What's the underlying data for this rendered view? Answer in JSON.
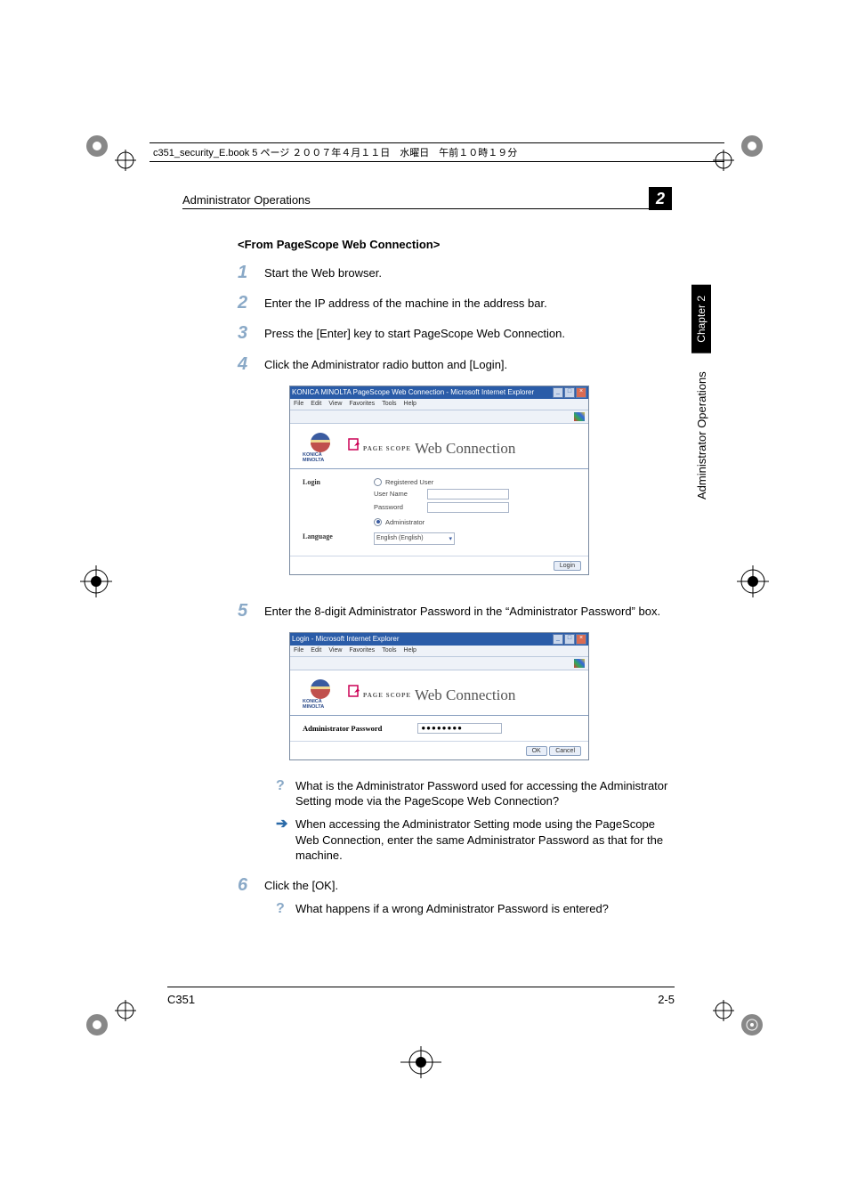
{
  "top_header": "c351_security_E.book  5 ページ  ２００７年４月１１日　水曜日　午前１０時１９分",
  "header": {
    "title": "Administrator Operations",
    "chapter_num": "2"
  },
  "side": {
    "chapter_label": "Chapter 2",
    "section_label": "Administrator Operations"
  },
  "section_title": "<From PageScope Web Connection>",
  "steps": [
    {
      "num": "1",
      "text": "Start the Web browser."
    },
    {
      "num": "2",
      "text": "Enter the IP address of the machine in the address bar."
    },
    {
      "num": "3",
      "text": "Press the [Enter] key to start PageScope Web Connection."
    },
    {
      "num": "4",
      "text": "Click the Administrator radio button and [Login]."
    },
    {
      "num": "5",
      "text": "Enter the 8-digit Administrator Password in the “Administrator Password” box."
    },
    {
      "num": "6",
      "text": "Click the [OK]."
    }
  ],
  "notes": {
    "q1": "What is the Administrator Password used for accessing the Administrator Setting mode via the PageScope Web Connection?",
    "a1": "When accessing the Administrator Setting mode using the PageScope Web Connection, enter the same Administrator Password as that for the machine.",
    "q2": "What happens if a wrong Administrator Password is entered?"
  },
  "screenshot1": {
    "title": "KONICA MINOLTA PageScope Web Connection - Microsoft Internet Explorer",
    "menu": [
      "File",
      "Edit",
      "View",
      "Favorites",
      "Tools",
      "Help"
    ],
    "km_brand": "KONICA MINOLTA",
    "ps_small": "PAGE SCOPE",
    "ps_big": "Web Connection",
    "login_label": "Login",
    "reg_user": "Registered User",
    "user_name": "User Name",
    "password": "Password",
    "admin": "Administrator",
    "language_label": "Language",
    "language_value": "English (English)",
    "login_btn": "Login"
  },
  "screenshot2": {
    "title": "Login - Microsoft Internet Explorer",
    "menu": [
      "File",
      "Edit",
      "View",
      "Favorites",
      "Tools",
      "Help"
    ],
    "km_brand": "KONICA MINOLTA",
    "ps_small": "PAGE SCOPE",
    "ps_big": "Web Connection",
    "pw_label": "Administrator Password",
    "pw_value": "●●●●●●●●",
    "ok_btn": "OK",
    "cancel_btn": "Cancel"
  },
  "footer": {
    "model": "C351",
    "page": "2-5"
  }
}
